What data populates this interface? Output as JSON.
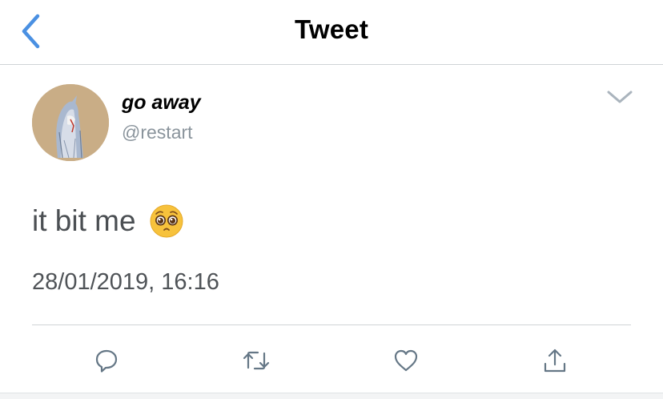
{
  "nav": {
    "title": "Tweet",
    "back_icon": "chevron-left-icon",
    "accent_color": "#4a90e2"
  },
  "tweet": {
    "author": {
      "display_name": "go away",
      "handle": "@restart",
      "avatar": "avatar-image"
    },
    "text": "it bit me",
    "emoji": "pleading-face",
    "timestamp": "28/01/2019, 16:16",
    "more_icon": "chevron-down-icon"
  },
  "actions": [
    {
      "name": "reply",
      "icon": "reply-icon"
    },
    {
      "name": "retweet",
      "icon": "retweet-icon"
    },
    {
      "name": "like",
      "icon": "heart-icon"
    },
    {
      "name": "share",
      "icon": "share-icon"
    }
  ],
  "colors": {
    "icon_gray": "#657786",
    "divider": "#cfd3d6"
  }
}
